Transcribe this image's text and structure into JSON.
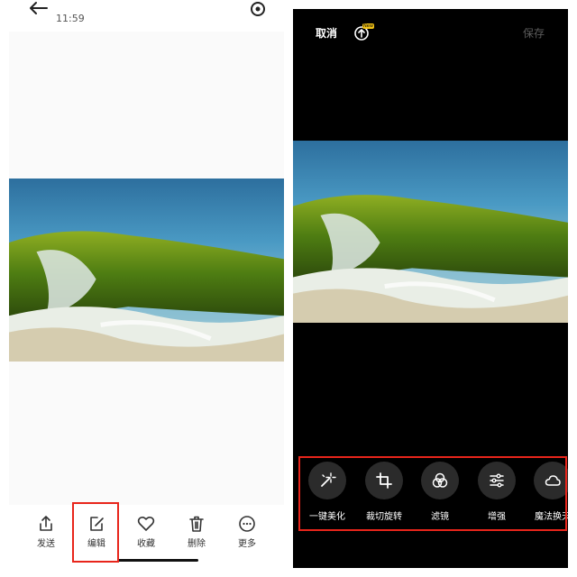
{
  "left": {
    "status_time": "11:59",
    "toolbar": [
      {
        "icon": "share-icon",
        "label": "发送"
      },
      {
        "icon": "edit-icon",
        "label": "编辑"
      },
      {
        "icon": "heart-icon",
        "label": "收藏"
      },
      {
        "icon": "trash-icon",
        "label": "删除"
      },
      {
        "icon": "more-icon",
        "label": "更多"
      }
    ]
  },
  "right": {
    "cancel_label": "取消",
    "new_badge": "New",
    "save_label": "保存",
    "tools": [
      {
        "icon": "magic-wand-icon",
        "label": "一键美化"
      },
      {
        "icon": "crop-rotate-icon",
        "label": "裁切旋转"
      },
      {
        "icon": "filter-icon",
        "label": "滤镜"
      },
      {
        "icon": "adjust-sliders-icon",
        "label": "增强"
      },
      {
        "icon": "cloud-icon",
        "label": "魔法换天"
      }
    ]
  },
  "colors": {
    "highlight": "#e8251b",
    "editor_bg": "#000000",
    "tool_circle": "#2b2b2b"
  }
}
